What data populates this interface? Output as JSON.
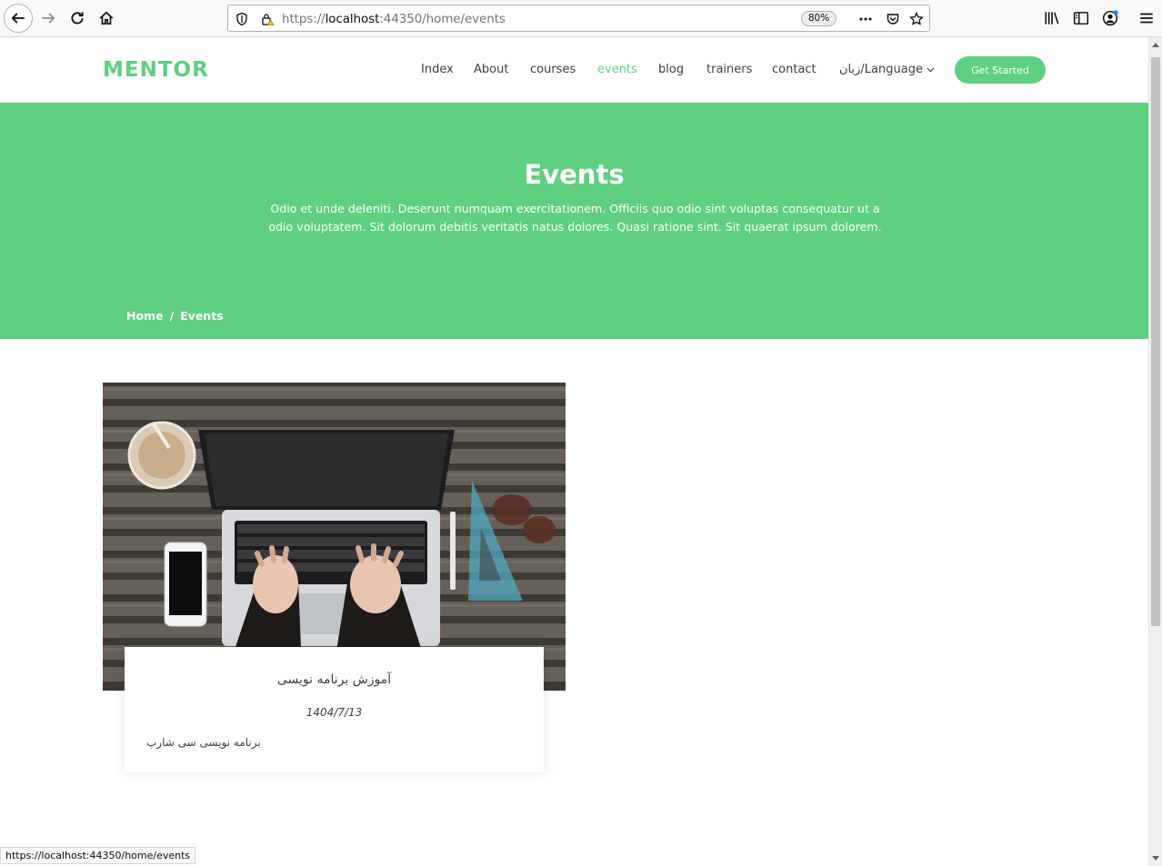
{
  "browser": {
    "url_prefix": "https://",
    "url_host": "localhost",
    "url_rest": ":44350/home/events",
    "zoom": "80%",
    "status_url": "https://localhost:44350/home/events"
  },
  "header": {
    "logo": "MENTOR",
    "nav": {
      "index": "Index",
      "about": "About",
      "courses": "courses",
      "events": "events",
      "blog": "blog",
      "trainers": "trainers",
      "contact": "contact",
      "language": "زبان/Language"
    },
    "cta": "Get Started",
    "accent_color": "#5fcf80"
  },
  "hero": {
    "title": "Events",
    "description": "Odio et unde deleniti. Deserunt numquam exercitationem. Officiis quo odio sint voluptas consequatur ut a odio voluptatem. Sit dolorum debitis veritatis natus dolores. Quasi ratione sint. Sit quaerat ipsum dolorem.",
    "breadcrumb": {
      "home": "Home",
      "separator": "/",
      "current": "Events"
    }
  },
  "events": [
    {
      "title": "آموزش برنامه نویسی",
      "date": "1404/7/13",
      "description": "برنامه نویسی سی شارپ"
    }
  ]
}
